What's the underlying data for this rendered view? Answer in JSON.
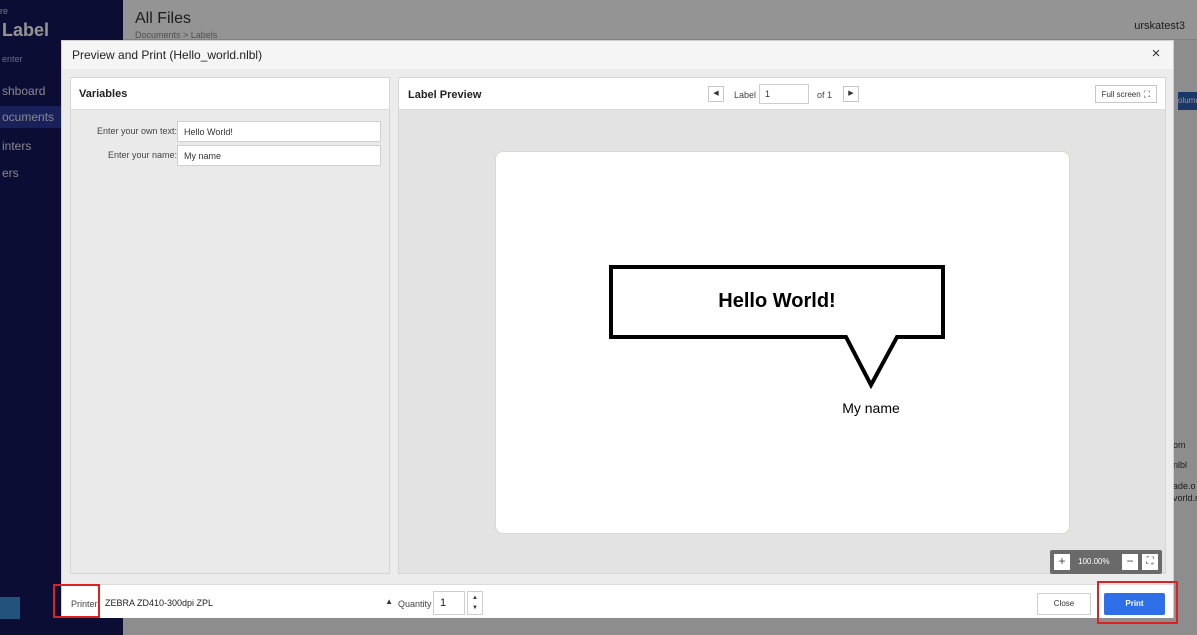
{
  "background_app": {
    "logo_top": "re",
    "logo": "Label",
    "logo_sub": "enter",
    "title": "All Files",
    "breadcrumb": "Documents > Labels",
    "user": "urskatest3",
    "sidebar_items": [
      {
        "label": "shboard",
        "active": false
      },
      {
        "label": "ocuments",
        "active": true
      },
      {
        "label": "inters",
        "active": false
      },
      {
        "label": "ers",
        "active": false
      }
    ],
    "columns_button": "olumn",
    "side_texts": [
      "om",
      "nlbl",
      "ade.o",
      "vorld.r"
    ]
  },
  "dialog": {
    "title": "Preview and Print (Hello_world.nlbl)",
    "close_icon": "×",
    "variables": {
      "heading": "Variables",
      "fields": [
        {
          "label": "Enter your own text:",
          "value": "Hello World!"
        },
        {
          "label": "Enter your name:",
          "value": "My name"
        }
      ]
    },
    "preview": {
      "heading": "Label Preview",
      "prev_icon": "◀",
      "next_icon": "▶",
      "label_word": "Label",
      "page": "1",
      "of_text": "of 1",
      "fullscreen": "Full screen",
      "fullscreen_icon": "⛶",
      "label_content": {
        "bubble_text": "Hello World!",
        "name_text": "My name"
      },
      "zoom": {
        "plus": "+",
        "value": "100.00%",
        "minus": "−",
        "fit_icon": "⛶"
      }
    },
    "footer": {
      "printer_label": "Printer",
      "printer_value": "ZEBRA ZD410-300dpi ZPL",
      "printer_caret": "▲",
      "quantity_label": "Quantity",
      "quantity_value": "1",
      "stepper_up": "▲",
      "stepper_down": "▼",
      "close_button": "Close",
      "print_button": "Print"
    }
  },
  "colors": {
    "sidebar": "#14185a",
    "print_button": "#2e6ee6",
    "highlight": "#e02020"
  }
}
